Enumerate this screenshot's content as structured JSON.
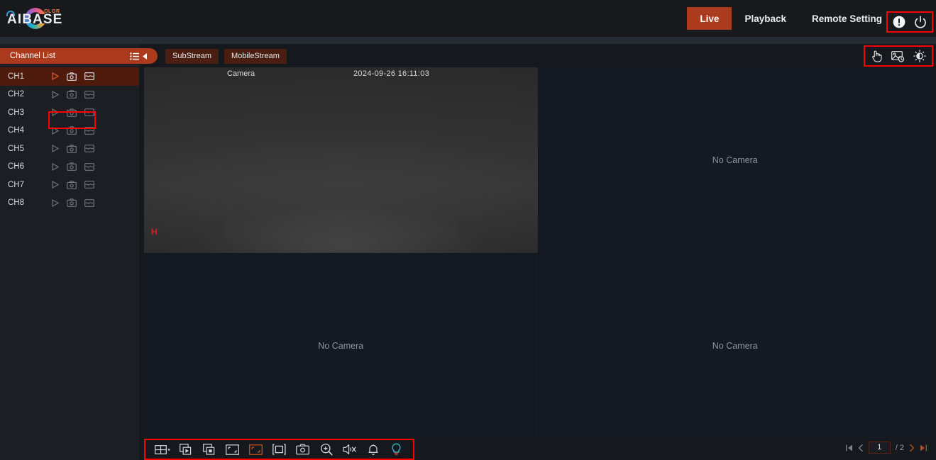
{
  "brand": {
    "name": "AIBASE",
    "superscript": "OLOR"
  },
  "header": {
    "nav": [
      {
        "label": "Live",
        "active": true
      },
      {
        "label": "Playback",
        "active": false
      },
      {
        "label": "Remote Setting",
        "active": false
      }
    ],
    "icons": [
      {
        "name": "alert-icon",
        "title": "Alert"
      },
      {
        "name": "power-icon",
        "title": "Power"
      }
    ]
  },
  "sidebar": {
    "title": "Channel List",
    "menu_icon": "list-icon",
    "collapse_icon": "collapse-left-icon",
    "channels": [
      {
        "label": "CH1",
        "selected": true
      },
      {
        "label": "CH2",
        "selected": false
      },
      {
        "label": "CH3",
        "selected": false
      },
      {
        "label": "CH4",
        "selected": false
      },
      {
        "label": "CH5",
        "selected": false
      },
      {
        "label": "CH6",
        "selected": false
      },
      {
        "label": "CH7",
        "selected": false
      },
      {
        "label": "CH8",
        "selected": false
      }
    ],
    "row_actions": [
      "play-icon",
      "snapshot-icon",
      "record-icon"
    ]
  },
  "stream_buttons": [
    {
      "label": "SubStream"
    },
    {
      "label": "MobileStream"
    }
  ],
  "top_right_tools": [
    {
      "name": "ptz-hand-icon"
    },
    {
      "name": "image-playback-icon"
    },
    {
      "name": "brightness-settings-icon"
    }
  ],
  "video_grid": {
    "layout": "2x2",
    "cells": [
      {
        "state": "streaming",
        "camera_name": "Camera",
        "timestamp": "2024-09-26 16:11:03",
        "stream_flag": "H",
        "selected": true
      },
      {
        "state": "empty",
        "placeholder": "No Camera",
        "selected": false
      },
      {
        "state": "empty",
        "placeholder": "No Camera",
        "selected": false
      },
      {
        "state": "empty",
        "placeholder": "No Camera",
        "selected": false
      }
    ]
  },
  "bottom_toolbar": [
    {
      "name": "grid-layout-icon",
      "active": false
    },
    {
      "name": "play-all-icon",
      "active": false
    },
    {
      "name": "stop-all-icon",
      "active": false
    },
    {
      "name": "original-proportion-icon",
      "active": false
    },
    {
      "name": "stretch-icon",
      "active": true
    },
    {
      "name": "fullscreen-icon",
      "active": false
    },
    {
      "name": "snapshot-icon",
      "active": false
    },
    {
      "name": "digital-zoom-icon",
      "active": false
    },
    {
      "name": "mute-icon",
      "active": false
    },
    {
      "name": "alarm-bell-icon",
      "active": false
    },
    {
      "name": "light-bulb-icon",
      "active": false
    }
  ],
  "pagination": {
    "first_icon": "first-page-icon",
    "prev_icon": "prev-page-icon",
    "current_page": "1",
    "total_label": "/ 2",
    "next_icon": "next-page-icon",
    "last_icon": "last-page-icon"
  },
  "colors": {
    "accent": "#ab3b1c",
    "highlight_box": "#ff0000",
    "active_cell_border": "#1fc8e0",
    "flag_red": "#d21f1f",
    "bulb_cyan": "#29c4d8"
  }
}
